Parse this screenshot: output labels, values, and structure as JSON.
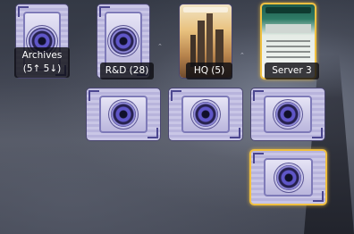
{
  "board": {
    "servers": [
      {
        "name": "Archives",
        "counts": "(5↑ 5↓)"
      },
      {
        "name": "R&D (28)"
      },
      {
        "name": "HQ (5)"
      },
      {
        "name": "Server 3"
      }
    ]
  },
  "colors": {
    "selected_border": "#f0c040",
    "card_back": "#c9c6e6",
    "label_bg": "#0f0f14"
  }
}
